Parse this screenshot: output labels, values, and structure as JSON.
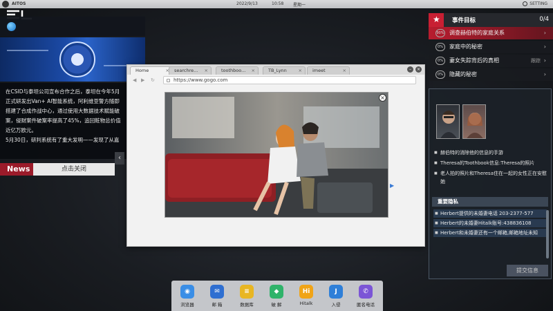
{
  "topbar": {
    "os_name": "AITOS",
    "date": "2022/9/13",
    "time": "10:58",
    "weekday": "星期一",
    "setting_label": "SETTING"
  },
  "news": {
    "paragraphs": [
      "在CSID与泰坦公司宣布合作之后，泰坦在今年5月正式研发出Van+ AI智能系统，阿利维亚警方随即搭建了合成作战中心，通过使用大数据技术赋能破案，侵财案件破案率提高了45%，追回赃物总价值近亿万欧元。",
      "5月30日，研判系统有了重大发明——发现了从嘉"
    ],
    "label": "News",
    "close_label": "点击关闭",
    "arrow": "‹"
  },
  "browser": {
    "tabs": [
      "Home",
      "searchre...",
      "toothboo...",
      "TB_Lynn",
      "imeet"
    ],
    "url": "https://www.gogo.com",
    "photo_close": "×"
  },
  "objectives": {
    "title": "事件目标",
    "count": "0/4",
    "items": [
      {
        "pct": "90%",
        "text": "调查赫伯特的家庭关系",
        "tag": "",
        "active": true
      },
      {
        "pct": "0%",
        "text": "家庭中的秘密",
        "tag": "",
        "active": false
      },
      {
        "pct": "0%",
        "text": "妻女失踪背后的真相",
        "tag": "跟踪",
        "active": false
      },
      {
        "pct": "0%",
        "text": "隐藏的秘密",
        "tag": "",
        "active": false
      }
    ]
  },
  "evidence": {
    "items": [
      "赫伯特的消除他的信息的手游",
      "Theresa的Toothbook信息:Theresa的照片",
      "老人拍的照片和Theresa住在一起的女性正在安慰她"
    ],
    "section_title": "重要隐私",
    "secrets": [
      "Herbert提供的未婚妻电话 203-2377-577",
      "Herbert的未婚妻Hitalk账号:438836108",
      "Herbert和未婚妻还有一个邮箱,邮箱地址未知"
    ],
    "submit_label": "提交信息"
  },
  "dock": {
    "items": [
      {
        "label": "浏览器",
        "icon": "browser-icon",
        "color": "#3a8ee6",
        "glyph": "◉"
      },
      {
        "label": "邮 箱",
        "icon": "mail-icon",
        "color": "#2f6fd1",
        "glyph": "✉"
      },
      {
        "label": "数据库",
        "icon": "database-icon",
        "color": "#e8b623",
        "glyph": "≡"
      },
      {
        "label": "破 解",
        "icon": "shield-icon",
        "color": "#2fb36a",
        "glyph": "◆"
      },
      {
        "label": "Hitalk",
        "icon": "chat-icon",
        "color": "#f0a417",
        "glyph": "Hi"
      },
      {
        "label": "入侵",
        "icon": "hook-icon",
        "color": "#2e7fd8",
        "glyph": "J"
      },
      {
        "label": "匿名电话",
        "icon": "phone-icon",
        "color": "#7b55d6",
        "glyph": "✆"
      }
    ]
  }
}
